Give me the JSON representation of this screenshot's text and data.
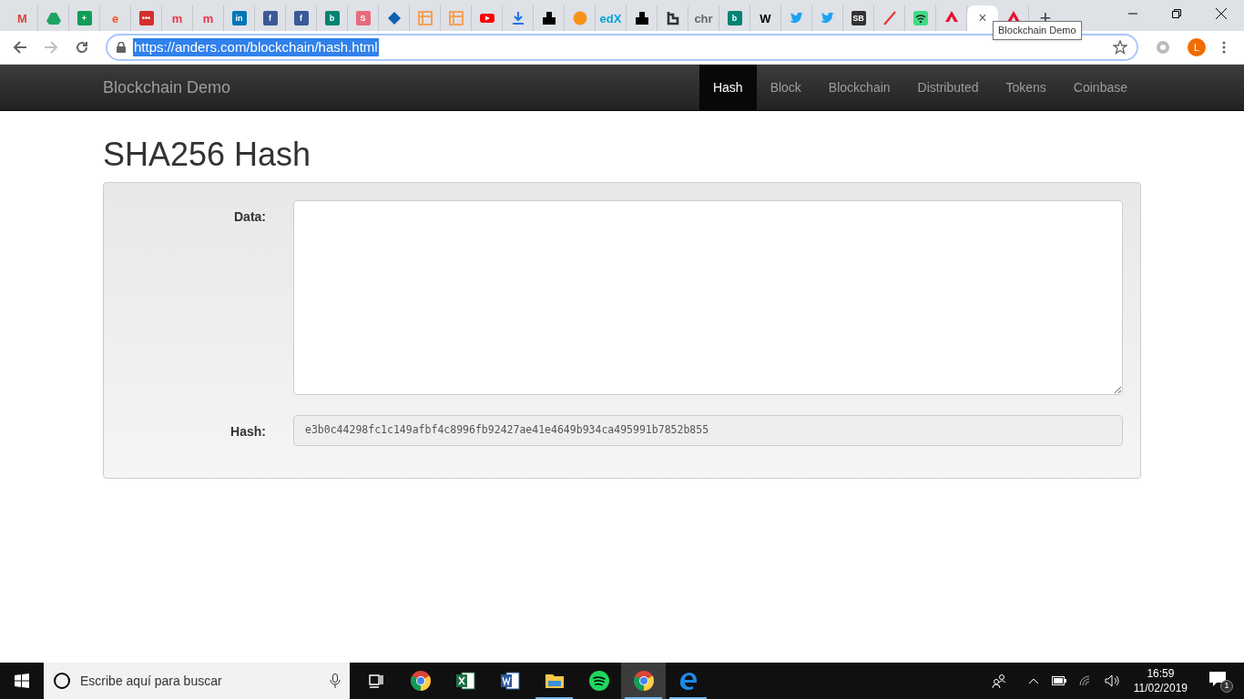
{
  "browser": {
    "tabs": [
      {
        "kind": "text",
        "glyph": "M",
        "color": "#d44638",
        "selected": false
      },
      {
        "kind": "drive",
        "color": "#1fa463",
        "selected": false
      },
      {
        "kind": "badge",
        "glyph": "+",
        "color": "#0f9d58",
        "selected": false
      },
      {
        "kind": "text",
        "glyph": "e",
        "color": "#f4511e",
        "selected": false
      },
      {
        "kind": "badge",
        "glyph": "•••",
        "color": "#d32f2f",
        "selected": false
      },
      {
        "kind": "text",
        "glyph": "m",
        "color": "#e8334a",
        "selected": false
      },
      {
        "kind": "text",
        "glyph": "m",
        "color": "#e8334a",
        "selected": false
      },
      {
        "kind": "badge",
        "glyph": "in",
        "color": "#0077b5",
        "selected": false
      },
      {
        "kind": "badge",
        "glyph": "f",
        "color": "#3b5998",
        "selected": false
      },
      {
        "kind": "badge",
        "glyph": "f",
        "color": "#3b5998",
        "selected": false
      },
      {
        "kind": "badge",
        "glyph": "b",
        "color": "#008373",
        "selected": false
      },
      {
        "kind": "badge",
        "glyph": "S",
        "color": "#e76a7d",
        "selected": false
      },
      {
        "kind": "diamond",
        "color": "#0f62ae",
        "selected": false
      },
      {
        "kind": "grid",
        "color": "#f4a259",
        "selected": false
      },
      {
        "kind": "grid",
        "color": "#f4a259",
        "selected": false
      },
      {
        "kind": "youtube",
        "color": "#ff0000",
        "selected": false
      },
      {
        "kind": "download",
        "color": "#1a73e8",
        "selected": false
      },
      {
        "kind": "blocks",
        "color": "#000000",
        "selected": false
      },
      {
        "kind": "bitcoin",
        "color": "#f7931a",
        "selected": false
      },
      {
        "kind": "text",
        "glyph": "edX",
        "color": "#02a2d8",
        "selected": false
      },
      {
        "kind": "blocks",
        "color": "#000000",
        "selected": false
      },
      {
        "kind": "hook",
        "color": "#333333",
        "selected": false
      },
      {
        "kind": "text",
        "glyph": "chr",
        "color": "#666666",
        "selected": false
      },
      {
        "kind": "badge",
        "glyph": "b",
        "color": "#008373",
        "selected": false
      },
      {
        "kind": "text",
        "glyph": "W",
        "color": "#000000",
        "selected": false
      },
      {
        "kind": "twitter",
        "color": "#1da1f2",
        "selected": false
      },
      {
        "kind": "twitter",
        "color": "#1da1f2",
        "selected": false
      },
      {
        "kind": "badge",
        "glyph": "SB",
        "color": "#333333",
        "selected": false
      },
      {
        "kind": "slash",
        "color": "#e53935",
        "selected": false
      },
      {
        "kind": "wifi",
        "color": "#3ddc84",
        "selected": false
      },
      {
        "kind": "peak",
        "color": "#e8112d",
        "selected": false
      },
      {
        "kind": "close",
        "glyph": "×",
        "color": "#5f6368",
        "selected": true
      },
      {
        "kind": "peak",
        "color": "#e8112d",
        "selected": false
      }
    ],
    "new_tab": "+",
    "tooltip": "Blockchain Demo",
    "address": "https://anders.com/blockchain/hash.html",
    "profile_initial": "L"
  },
  "navbar": {
    "brand": "Blockchain Demo",
    "items": [
      {
        "label": "Hash",
        "selected": true
      },
      {
        "label": "Block",
        "selected": false
      },
      {
        "label": "Blockchain",
        "selected": false
      },
      {
        "label": "Distributed",
        "selected": false
      },
      {
        "label": "Tokens",
        "selected": false
      },
      {
        "label": "Coinbase",
        "selected": false
      }
    ]
  },
  "page": {
    "title": "SHA256 Hash",
    "fields": [
      {
        "label": "Data:",
        "kind": "textarea"
      },
      {
        "label": "Hash:",
        "kind": "readonly",
        "value": "e3b0c44298fc1c149afbf4c8996fb92427ae41e4649b934ca495991b7852b855"
      }
    ]
  },
  "taskbar": {
    "search_placeholder": "Escribe aquí para buscar",
    "apps": [
      {
        "kind": "taskview",
        "running": false,
        "active": false
      },
      {
        "kind": "chrome",
        "running": false,
        "active": false
      },
      {
        "kind": "excel",
        "running": false,
        "active": false
      },
      {
        "kind": "word",
        "running": false,
        "active": false
      },
      {
        "kind": "explorer",
        "running": true,
        "active": false
      },
      {
        "kind": "spotify",
        "running": false,
        "active": false
      },
      {
        "kind": "chrome",
        "running": true,
        "active": true
      },
      {
        "kind": "edge",
        "running": true,
        "active": false
      }
    ],
    "time": "16:59",
    "date": "11/02/2019",
    "notifications": "1"
  }
}
